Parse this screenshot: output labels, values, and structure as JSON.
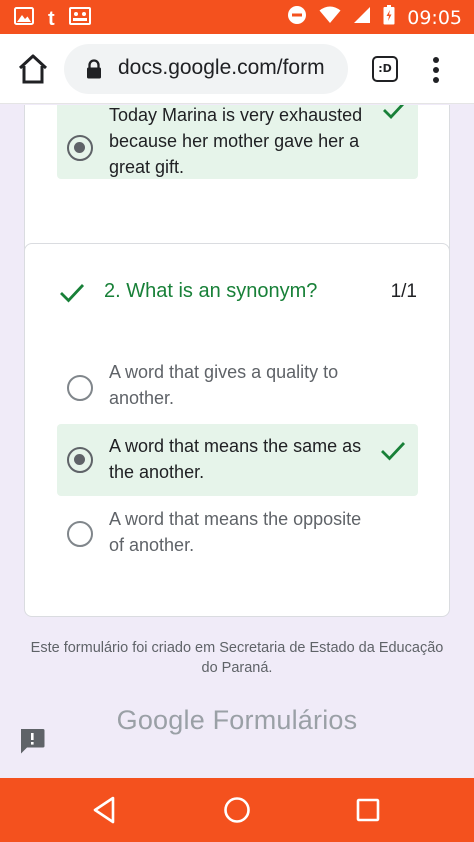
{
  "statusbar": {
    "time": "09:05",
    "left_letter": "t"
  },
  "browser": {
    "url": "docs.google.com/form",
    "tabs_label": ":D"
  },
  "question1": {
    "option_text": "Today Marina is very exhausted because her mother gave her a great gift."
  },
  "question2": {
    "title": "2. What is an synonym?",
    "score": "1/1",
    "options": [
      {
        "text": "A word that gives a quality to another.",
        "selected": false,
        "correct": false
      },
      {
        "text": "A word that means the same as the another.",
        "selected": true,
        "correct": true
      },
      {
        "text": "A word that means the opposite of another.",
        "selected": false,
        "correct": false
      }
    ]
  },
  "footer": {
    "note": "Este formulário foi criado em Secretaria de Estado da Educação do Paraná.",
    "brand": "Google Formulários"
  },
  "colors": {
    "status_bar": "#f4511e",
    "correct_bg": "#e6f4ea",
    "correct_green": "#188038",
    "page_bg": "#f0ebf8"
  }
}
